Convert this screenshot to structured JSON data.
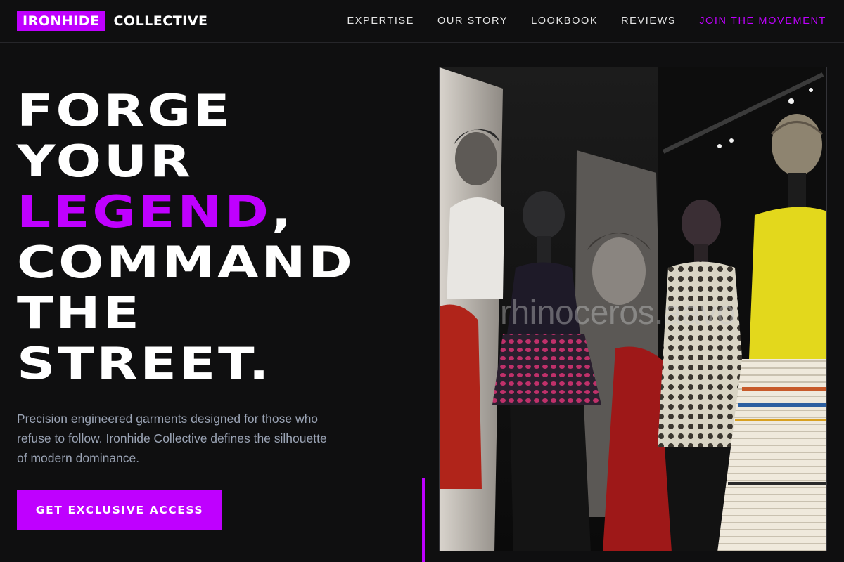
{
  "brand": {
    "highlight": "IRONHIDE",
    "rest": "COLLECTIVE",
    "accent_color": "#bf00ff"
  },
  "nav": {
    "items": [
      {
        "label": "EXPERTISE"
      },
      {
        "label": "OUR STORY"
      },
      {
        "label": "LOOKBOOK"
      },
      {
        "label": "REVIEWS"
      },
      {
        "label": "JOIN THE MOVEMENT"
      }
    ]
  },
  "hero": {
    "line1": "FORGE",
    "line2": "YOUR",
    "line3_highlight": "LEGEND",
    "line3_suffix": ",",
    "line4": "COMMAND",
    "line5": "THE",
    "line6": "STREET.",
    "description": "Precision engineered garments designed for those who refuse to follow. Ironhide Collective defines the silhouette of modern dominance.",
    "cta_label": "GET EXCLUSIVE ACCESS"
  },
  "image": {
    "watermark": "rhinoceros.aavo"
  }
}
